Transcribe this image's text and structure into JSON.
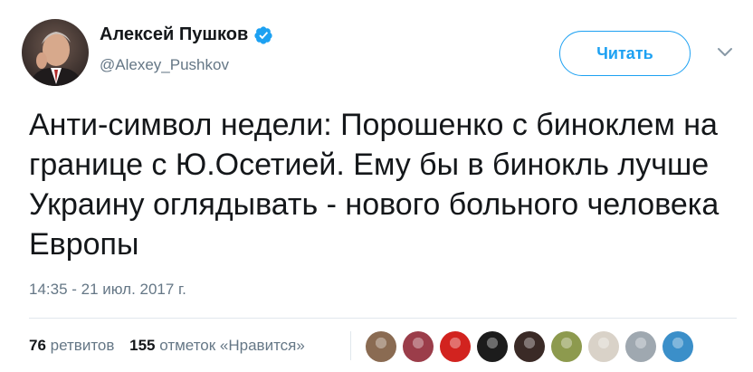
{
  "author": {
    "display_name": "Алексей Пушков",
    "handle": "@Alexey_Pushkov",
    "verified": true
  },
  "follow_button": {
    "label": "Читать"
  },
  "menu": {
    "icon": "chevron-down-icon"
  },
  "tweet": {
    "text": "Анти-символ недели: Порошенко с биноклем на границе с Ю.Осетией. Ему бы в бинокль лучше Украину оглядывать - нового больного человека Европы",
    "timestamp": "14:35 - 21 июл. 2017 г."
  },
  "stats": {
    "retweets_count": "76",
    "retweets_label": "ретвитов",
    "likes_count": "155",
    "likes_label": "отметок «Нравится»"
  },
  "liker_avatars": [
    {
      "name": "liker-avatar-1",
      "color": "#8a6b52"
    },
    {
      "name": "liker-avatar-2",
      "color": "#9b3d4a"
    },
    {
      "name": "liker-avatar-3",
      "color": "#d2231f"
    },
    {
      "name": "liker-avatar-4",
      "color": "#1c1c1c"
    },
    {
      "name": "liker-avatar-5",
      "color": "#3a2a26"
    },
    {
      "name": "liker-avatar-6",
      "color": "#8d9a4e"
    },
    {
      "name": "liker-avatar-7",
      "color": "#d9d2c8"
    },
    {
      "name": "liker-avatar-8",
      "color": "#9fa8b0"
    },
    {
      "name": "liker-avatar-9",
      "color": "#3b8fc9"
    }
  ],
  "colors": {
    "accent": "#1da1f2",
    "text": "#14171a",
    "secondary_text": "#657786",
    "divider": "#e1e8ed"
  }
}
